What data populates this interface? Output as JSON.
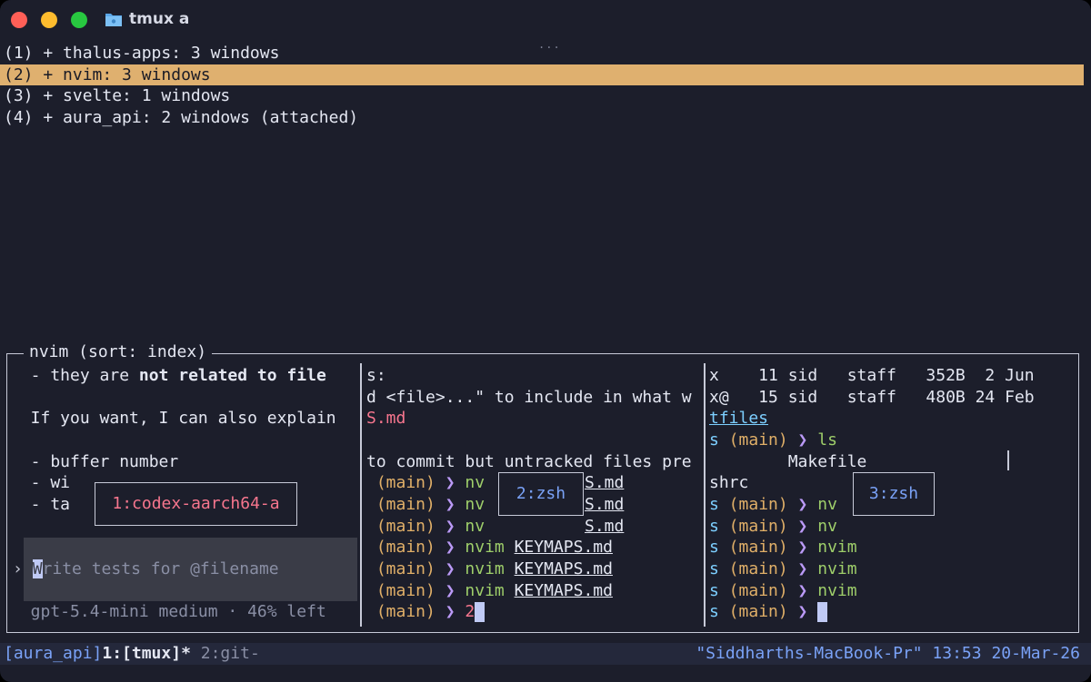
{
  "window": {
    "title": "tmux a",
    "grip": "..."
  },
  "sessions": [
    {
      "label": "(1) + thalus-apps: 3 windows",
      "selected": false
    },
    {
      "label": "(2) + nvim: 3 windows",
      "selected": true
    },
    {
      "label": "(3) + svelte: 1 windows",
      "selected": false
    },
    {
      "label": "(4) + aura_api: 2 windows (attached)",
      "selected": false
    }
  ],
  "preview": {
    "title": "nvim (sort: index)",
    "pane1": {
      "line1_pre": "  - they are ",
      "line1_bold": "not related to file",
      "line3": "  If you want, I can also explain",
      "line5": "  - buffer number",
      "line6": "  - wi",
      "line7": "  - ta",
      "prompt_marker": "›",
      "input_first": "W",
      "input_rest": "rite tests for @filename",
      "footer": "  gpt-5.4-mini medium · 46% left",
      "window_label": "1:codex-aarch64-a"
    },
    "pane2": {
      "line1": "s:",
      "line2": "d <file>...\" to include in what w",
      "line3": "S.md",
      "line5": "to commit but untracked files pre",
      "branch": " (main) ",
      "arrow": "❯",
      "cmd_nv": "nv",
      "cmd_nvim": "nvim",
      "file_short": "S.md",
      "file_keymaps": "KEYMAPS.md",
      "last_cmd": "2",
      "window_label": "2:zsh"
    },
    "pane3": {
      "line1": "x    11 sid   staff   352B  2 Jun",
      "line2": "x@   15 sid   staff   480B 24 Feb",
      "line3": "tfiles",
      "prefix": "s",
      "branch": " (main) ",
      "arrow": "❯",
      "cmd_ls": "ls",
      "line5": "        Makefile",
      "line6": "shrc",
      "cmd_nv": "nv",
      "cmd_nvim": "nvim",
      "window_label": "3:zsh"
    }
  },
  "statusbar": {
    "session": "[aura_api]",
    "window1": "1:[tmux]*",
    "window2": " 2:git-",
    "host": "\"Siddharths-MacBook-Pr\"",
    "time": "13:53",
    "date": "20-Mar-26"
  },
  "colors": {
    "background": "#1c1e2b",
    "selection": "#dfb06f",
    "red": "#f7768e",
    "orange": "#e0af68",
    "purple": "#bb9af7",
    "green": "#9ece6a",
    "blue": "#7aa2f7"
  },
  "icons": {
    "title_icon": "folder-icon"
  }
}
